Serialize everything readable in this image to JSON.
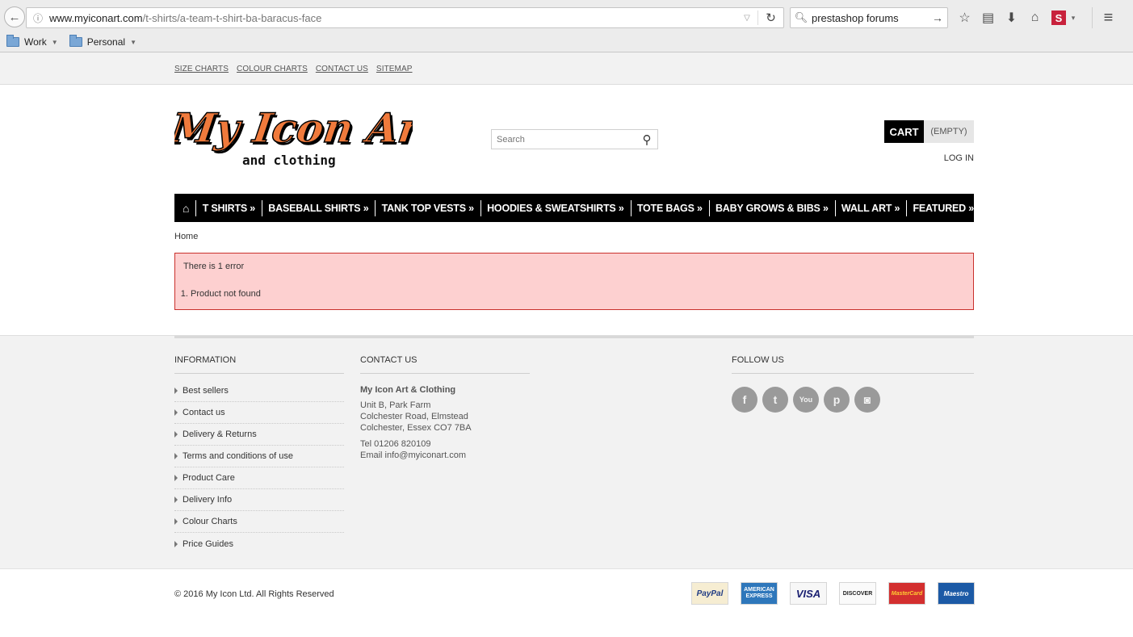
{
  "browser": {
    "url_host": "www.myiconart.com",
    "url_path": "/t-shirts/a-team-t-shirt-ba-baracus-face",
    "search_value": "prestashop forums",
    "bookmarks": [
      {
        "label": "Work"
      },
      {
        "label": "Personal"
      }
    ]
  },
  "site": {
    "top_links": [
      "SIZE CHARTS",
      "COLOUR CHARTS",
      "CONTACT US",
      "SITEMAP"
    ],
    "logo": {
      "line1": "My Icon Art",
      "line2": "and clothing"
    },
    "search_placeholder": "Search",
    "cart_label": "CART",
    "cart_status": "(EMPTY)",
    "login_label": "LOG IN",
    "menu": [
      "T SHIRTS »",
      "BASEBALL SHIRTS »",
      "TANK TOP VESTS »",
      "HOODIES & SWEATSHIRTS »",
      "TOTE BAGS »",
      "BABY GROWS & BIBS »",
      "WALL ART »",
      "FEATURED »"
    ],
    "breadcrumb": "Home",
    "error": {
      "title": "There is 1 error",
      "items": [
        "Product not found"
      ]
    }
  },
  "footer": {
    "info_heading": "INFORMATION",
    "info_links": [
      "Best sellers",
      "Contact us",
      "Delivery & Returns",
      "Terms and conditions of use",
      "Product Care",
      "Delivery Info",
      "Colour Charts",
      "Price Guides"
    ],
    "contact_heading": "CONTACT US",
    "contact_name": "My Icon Art & Clothing",
    "address": [
      "Unit B, Park Farm",
      "Colchester Road, Elmstead",
      "Colchester, Essex CO7 7BA"
    ],
    "tel": "Tel 01206 820109",
    "email": "Email info@myiconart.com",
    "follow_heading": "FOLLOW US",
    "socials": [
      {
        "icon": "facebook-icon",
        "glyph": "f"
      },
      {
        "icon": "twitter-icon",
        "glyph": "t"
      },
      {
        "icon": "youtube-icon",
        "glyph": "You"
      },
      {
        "icon": "pinterest-icon",
        "glyph": "p"
      },
      {
        "icon": "instagram-icon",
        "glyph": "◙"
      }
    ],
    "copyright": "© 2016 My Icon Ltd. All Rights Reserved",
    "payments": [
      {
        "icon": "paypal-icon",
        "label": "PayPal"
      },
      {
        "icon": "amex-icon",
        "label": "AMERICAN EXPRESS"
      },
      {
        "icon": "visa-icon",
        "label": "VISA"
      },
      {
        "icon": "discover-icon",
        "label": "DISCOVER"
      },
      {
        "icon": "mastercard-icon",
        "label": "MasterCard"
      },
      {
        "icon": "maestro-icon",
        "label": "Maestro"
      }
    ]
  },
  "colors": {
    "logo_orange": "#f07a3c",
    "error_bg": "#fdd0d0",
    "error_border": "#c9302c",
    "menu_bg": "#000000"
  }
}
